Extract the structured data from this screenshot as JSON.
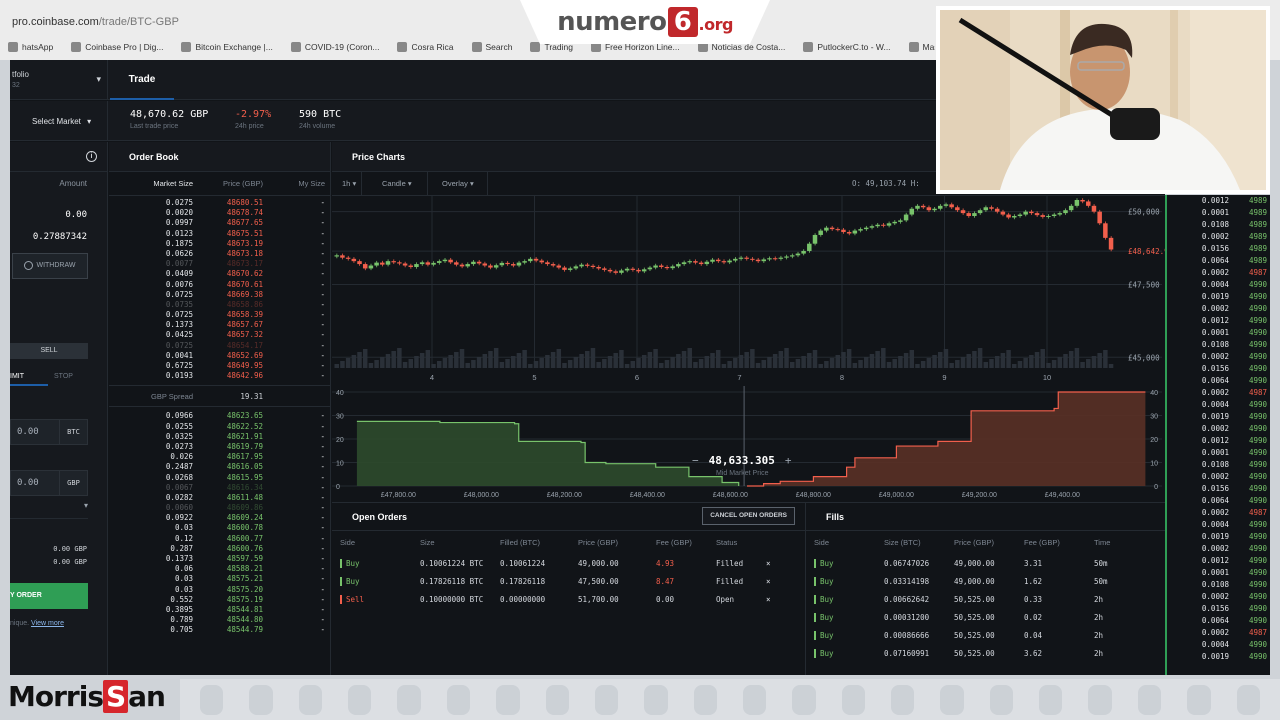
{
  "browser": {
    "url_host": "pro.coinbase.com",
    "url_path": "/trade/BTC-GBP",
    "bookmarks": [
      "hatsApp",
      "Coinbase Pro | Dig...",
      "Bitcoin Exchange |...",
      "COVID-19 (Coron...",
      "Cosra Rica",
      "Search",
      "Trading",
      "Free Horizon Line...",
      "Noticias de Costa...",
      "PutlockerC.to - W...",
      "Masso"
    ]
  },
  "overlay_logo": {
    "pre": "numero",
    "num": "6",
    "suffix": ".org"
  },
  "watermark": {
    "pre": "Morris",
    "boxed": "S",
    "post": "an"
  },
  "header": {
    "portfolio_label": "tfolio",
    "portfolio_sub": "32",
    "trade_tab": "Trade"
  },
  "market": {
    "select_label": "Select Market",
    "last_price": "48,670.62 GBP",
    "last_price_label": "Last trade price",
    "change": "-2.97%",
    "change_label": "24h price",
    "volume": "590 BTC",
    "volume_label": "24h volume"
  },
  "form": {
    "amount_label": "Amount",
    "balance_1": "0.00",
    "balance_2": "0.27887342",
    "withdraw": "WITHDRAW",
    "sell": "SELL",
    "limit": "IMIT",
    "stop": "STOP",
    "amount_value": "0.00",
    "amount_unit": "BTC",
    "price_value": "0.00",
    "price_unit": "GBP",
    "total_1": "0.00 GBP",
    "total_2": "0.00 GBP",
    "place_order": "Y ORDER",
    "footer_text": "nique.",
    "footer_link": "View more"
  },
  "orderbook": {
    "title": "Order Book",
    "col_size": "Market Size",
    "col_price": "Price (GBP)",
    "col_mine": "My Size",
    "spread_label": "GBP Spread",
    "spread_value": "19.31",
    "asks": [
      {
        "size": "0.0275",
        "price": "48680.51",
        "mine": "-",
        "faded": false
      },
      {
        "size": "0.0020",
        "price": "48678.74",
        "mine": "-",
        "faded": false
      },
      {
        "size": "0.0997",
        "price": "48677.65",
        "mine": "-",
        "faded": false
      },
      {
        "size": "0.0123",
        "price": "48675.51",
        "mine": "-",
        "faded": false
      },
      {
        "size": "0.1875",
        "price": "48673.19",
        "mine": "-",
        "faded": false
      },
      {
        "size": "0.0626",
        "price": "48673.18",
        "mine": "-",
        "faded": false
      },
      {
        "size": "0.0077",
        "price": "48673.17",
        "mine": "-",
        "faded": true
      },
      {
        "size": "0.0409",
        "price": "48670.62",
        "mine": "-",
        "faded": false
      },
      {
        "size": "0.0076",
        "price": "48670.61",
        "mine": "-",
        "faded": false
      },
      {
        "size": "0.0725",
        "price": "48669.38",
        "mine": "-",
        "faded": false
      },
      {
        "size": "0.0735",
        "price": "48658.86",
        "mine": "-",
        "faded": true
      },
      {
        "size": "0.0725",
        "price": "48658.39",
        "mine": "-",
        "faded": false
      },
      {
        "size": "0.1373",
        "price": "48657.67",
        "mine": "-",
        "faded": false
      },
      {
        "size": "0.0425",
        "price": "48657.32",
        "mine": "-",
        "faded": false
      },
      {
        "size": "0.0725",
        "price": "48654.17",
        "mine": "-",
        "faded": true
      },
      {
        "size": "0.0041",
        "price": "48652.69",
        "mine": "-",
        "faded": false
      },
      {
        "size": "0.6725",
        "price": "48649.95",
        "mine": "-",
        "faded": false
      },
      {
        "size": "0.0193",
        "price": "48642.96",
        "mine": "-",
        "faded": false
      }
    ],
    "bids": [
      {
        "size": "0.0966",
        "price": "48623.65",
        "mine": "-",
        "faded": false
      },
      {
        "size": "0.0255",
        "price": "48622.52",
        "mine": "-",
        "faded": false
      },
      {
        "size": "0.0325",
        "price": "48621.91",
        "mine": "-",
        "faded": false
      },
      {
        "size": "0.0273",
        "price": "48619.79",
        "mine": "-",
        "faded": false
      },
      {
        "size": "0.026",
        "price": "48617.95",
        "mine": "-",
        "faded": false
      },
      {
        "size": "0.2487",
        "price": "48616.05",
        "mine": "-",
        "faded": false
      },
      {
        "size": "0.0268",
        "price": "48615.95",
        "mine": "-",
        "faded": false
      },
      {
        "size": "0.0067",
        "price": "48616.34",
        "mine": "-",
        "faded": true
      },
      {
        "size": "0.0282",
        "price": "48611.48",
        "mine": "-",
        "faded": false
      },
      {
        "size": "0.0060",
        "price": "48609.86",
        "mine": "-",
        "faded": true
      },
      {
        "size": "0.0922",
        "price": "48609.24",
        "mine": "-",
        "faded": false
      },
      {
        "size": "0.03",
        "price": "48600.78",
        "mine": "-",
        "faded": false
      },
      {
        "size": "0.12",
        "price": "48600.77",
        "mine": "-",
        "faded": false
      },
      {
        "size": "0.287",
        "price": "48600.76",
        "mine": "-",
        "faded": false
      },
      {
        "size": "0.1373",
        "price": "48597.59",
        "mine": "-",
        "faded": false
      },
      {
        "size": "0.06",
        "price": "48588.21",
        "mine": "-",
        "faded": false
      },
      {
        "size": "0.03",
        "price": "48575.21",
        "mine": "-",
        "faded": false
      },
      {
        "size": "0.03",
        "price": "48575.20",
        "mine": "-",
        "faded": false
      },
      {
        "size": "0.552",
        "price": "48575.19",
        "mine": "-",
        "faded": false
      },
      {
        "size": "0.3895",
        "price": "48544.81",
        "mine": "-",
        "faded": false
      },
      {
        "size": "0.789",
        "price": "48544.80",
        "mine": "-",
        "faded": false
      },
      {
        "size": "0.705",
        "price": "48544.79",
        "mine": "-",
        "faded": false
      }
    ]
  },
  "charts": {
    "title": "Price Charts",
    "interval": "1h",
    "chart_type": "Candle",
    "overlay": "Overlay",
    "readout": "O: 49,103.74  H:",
    "mid_price": "48,633.305",
    "mid_label": "Mid Market Price",
    "minus": "−",
    "plus": "+",
    "price_labels": [
      "£50,000",
      "£48,642.96",
      "£47,500",
      "£45,000"
    ],
    "day_labels": [
      "4",
      "5",
      "6",
      "7",
      "8",
      "9",
      "10"
    ],
    "depth_x_labels": [
      "£47,800.00",
      "£48,000.00",
      "£48,200.00",
      "£48,400.00",
      "£48,600.00",
      "£48,800.00",
      "£49,000.00",
      "£49,200.00",
      "£49,400.00"
    ],
    "depth_y_labels": [
      "40",
      "30",
      "20",
      "10",
      "0"
    ],
    "colors": {
      "bid": "#78c36b",
      "ask": "#f25f4c",
      "grid": "#242a31"
    }
  },
  "candles": [
    48500,
    48420,
    48380,
    48300,
    48200,
    48050,
    48150,
    48250,
    48180,
    48300,
    48260,
    48220,
    48150,
    48100,
    48200,
    48260,
    48180,
    48240,
    48300,
    48350,
    48260,
    48180,
    48120,
    48200,
    48280,
    48220,
    48150,
    48080,
    48160,
    48240,
    48200,
    48150,
    48250,
    48300,
    48380,
    48320,
    48260,
    48200,
    48150,
    48080,
    48000,
    48050,
    48120,
    48180,
    48140,
    48100,
    48050,
    48000,
    47950,
    47900,
    47980,
    48040,
    48000,
    47950,
    48020,
    48080,
    48150,
    48100,
    48060,
    48120,
    48200,
    48260,
    48300,
    48250,
    48200,
    48280,
    48350,
    48300,
    48260,
    48320,
    48380,
    48420,
    48380,
    48350,
    48300,
    48360,
    48400,
    48380,
    48420,
    48460,
    48500,
    48560,
    48650,
    48900,
    49200,
    49350,
    49450,
    49400,
    49380,
    49300,
    49250,
    49350,
    49400,
    49450,
    49500,
    49550,
    49520,
    49600,
    49650,
    49700,
    49900,
    50100,
    50200,
    50150,
    50050,
    50100,
    50200,
    50250,
    50150,
    50050,
    49950,
    49850,
    49950,
    50050,
    50150,
    50100,
    50000,
    49900,
    49800,
    49850,
    49900,
    50000,
    49950,
    49880,
    49820,
    49850,
    49900,
    49950,
    50050,
    50200,
    50400,
    50350,
    50200,
    50000,
    49600,
    49100,
    48700
  ],
  "depth": {
    "bids": [
      [
        47700,
        27.5
      ],
      [
        47900,
        27
      ],
      [
        48080,
        26.5
      ],
      [
        48090,
        19
      ],
      [
        48240,
        18.5
      ],
      [
        48250,
        10
      ],
      [
        48300,
        9.5
      ],
      [
        48420,
        8
      ],
      [
        48500,
        4
      ],
      [
        48580,
        1.5
      ],
      [
        48620,
        0
      ]
    ],
    "asks": [
      [
        48640,
        0
      ],
      [
        48680,
        1
      ],
      [
        48720,
        2
      ],
      [
        48800,
        4
      ],
      [
        48880,
        8
      ],
      [
        48900,
        12
      ],
      [
        49000,
        17
      ],
      [
        49100,
        19
      ],
      [
        49180,
        32
      ],
      [
        49380,
        33
      ],
      [
        49390,
        40
      ],
      [
        49600,
        40
      ]
    ]
  },
  "open_orders": {
    "title": "Open Orders",
    "cancel_all": "CANCEL OPEN ORDERS",
    "columns": [
      "Side",
      "Size",
      "Filled (BTC)",
      "Price (GBP)",
      "Fee (GBP)",
      "Status"
    ],
    "rows": [
      {
        "side": "Buy",
        "size": "0.10061224 BTC",
        "filled": "0.10061224",
        "price": "49,000.00",
        "fee": "4.93",
        "status": "Filled"
      },
      {
        "side": "Buy",
        "size": "0.17826118 BTC",
        "filled": "0.17826118",
        "price": "47,500.00",
        "fee": "8.47",
        "status": "Filled"
      },
      {
        "side": "Sell",
        "size": "0.10000000 BTC",
        "filled": "0.00000000",
        "price": "51,700.00",
        "fee": "0.00",
        "status": "Open"
      }
    ],
    "close": "×"
  },
  "fills": {
    "title": "Fills",
    "columns": [
      "Side",
      "Size (BTC)",
      "Price (GBP)",
      "Fee (GBP)",
      "Time"
    ],
    "rows": [
      {
        "side": "Buy",
        "size": "0.06747026",
        "price": "49,000.00",
        "fee": "3.31",
        "time": "50m"
      },
      {
        "side": "Buy",
        "size": "0.03314198",
        "price": "49,000.00",
        "fee": "1.62",
        "time": "50m"
      },
      {
        "side": "Buy",
        "size": "0.00662642",
        "price": "50,525.00",
        "fee": "0.33",
        "time": "2h"
      },
      {
        "side": "Buy",
        "size": "0.00031200",
        "price": "50,525.00",
        "fee": "0.02",
        "time": "2h"
      },
      {
        "side": "Buy",
        "size": "0.00086666",
        "price": "50,525.00",
        "fee": "0.04",
        "time": "2h"
      },
      {
        "side": "Buy",
        "size": "0.07160991",
        "price": "50,525.00",
        "fee": "3.62",
        "time": "2h"
      }
    ]
  },
  "edge_book": [
    {
      "size": "0.0012",
      "price": "4989"
    },
    {
      "size": "0.0001",
      "price": "4989"
    },
    {
      "size": "0.0108",
      "price": "4989"
    },
    {
      "size": "0.0002",
      "price": "4989"
    },
    {
      "size": "0.0156",
      "price": "4989"
    },
    {
      "size": "0.0064",
      "price": "4989"
    },
    {
      "size": "0.0002",
      "price": "4987",
      "red": true
    },
    {
      "size": "0.0004",
      "price": "4990"
    },
    {
      "size": "0.0019",
      "price": "4990"
    },
    {
      "size": "0.0002",
      "price": "4990"
    },
    {
      "size": "0.0012",
      "price": "4990"
    },
    {
      "size": "0.0001",
      "price": "4990"
    },
    {
      "size": "0.0108",
      "price": "4990"
    },
    {
      "size": "0.0002",
      "price": "4990"
    },
    {
      "size": "0.0156",
      "price": "4990"
    },
    {
      "size": "0.0064",
      "price": "4990"
    },
    {
      "size": "0.0002",
      "price": "4987",
      "red": true
    },
    {
      "size": "0.0004",
      "price": "4990"
    },
    {
      "size": "0.0019",
      "price": "4990"
    },
    {
      "size": "0.0002",
      "price": "4990"
    },
    {
      "size": "0.0012",
      "price": "4990"
    },
    {
      "size": "0.0001",
      "price": "4990"
    },
    {
      "size": "0.0108",
      "price": "4990"
    },
    {
      "size": "0.0002",
      "price": "4990"
    },
    {
      "size": "0.0156",
      "price": "4990"
    },
    {
      "size": "0.0064",
      "price": "4990"
    },
    {
      "size": "0.0002",
      "price": "4987",
      "red": true
    },
    {
      "size": "0.0004",
      "price": "4990"
    },
    {
      "size": "0.0019",
      "price": "4990"
    },
    {
      "size": "0.0002",
      "price": "4990"
    },
    {
      "size": "0.0012",
      "price": "4990"
    },
    {
      "size": "0.0001",
      "price": "4990"
    },
    {
      "size": "0.0108",
      "price": "4990"
    },
    {
      "size": "0.0002",
      "price": "4990"
    },
    {
      "size": "0.0156",
      "price": "4990"
    },
    {
      "size": "0.0064",
      "price": "4990"
    },
    {
      "size": "0.0002",
      "price": "4987",
      "red": true
    },
    {
      "size": "0.0004",
      "price": "4990"
    },
    {
      "size": "0.0019",
      "price": "4990"
    }
  ]
}
